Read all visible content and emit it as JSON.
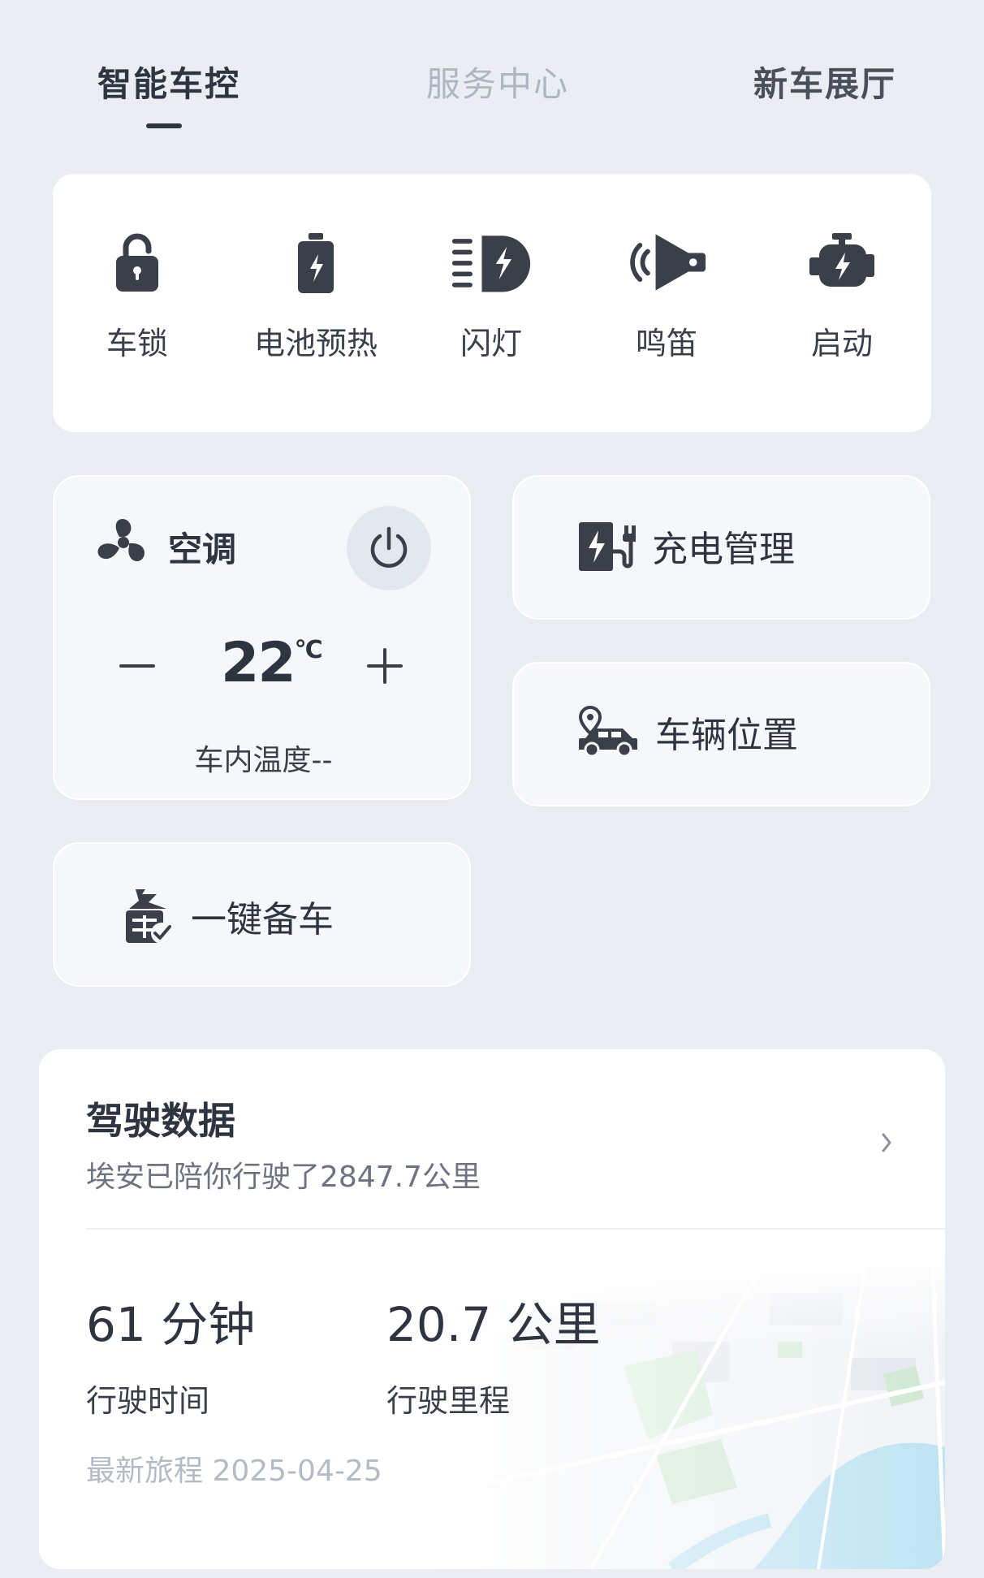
{
  "tabs": [
    {
      "label": "智能车控",
      "active": true
    },
    {
      "label": "服务中心",
      "active": false
    },
    {
      "label": "新车展厅",
      "active": false
    }
  ],
  "quick_controls": [
    {
      "label": "车锁",
      "icon": "lock-icon"
    },
    {
      "label": "电池预热",
      "icon": "battery-icon"
    },
    {
      "label": "闪灯",
      "icon": "headlight-icon"
    },
    {
      "label": "鸣笛",
      "icon": "horn-icon"
    },
    {
      "label": "启动",
      "icon": "engine-icon"
    }
  ],
  "ac": {
    "title": "空调",
    "temperature": "22",
    "unit": "°C",
    "inside_temp_label": "车内温度--"
  },
  "charge": {
    "label": "充电管理"
  },
  "location": {
    "label": "车辆位置"
  },
  "prepare": {
    "label": "一键备车"
  },
  "drive": {
    "title": "驾驶数据",
    "subtitle": "埃安已陪你行驶了2847.7公里",
    "time_value": "61 分钟",
    "time_label": "行驶时间",
    "distance_value": "20.7 公里",
    "distance_label": "行驶里程",
    "latest_trip": "最新旅程 2025-04-25"
  },
  "colors": {
    "background": "#eaeef3",
    "text": "#2f3441",
    "muted": "#aeb6c2",
    "card": "#ffffff"
  }
}
